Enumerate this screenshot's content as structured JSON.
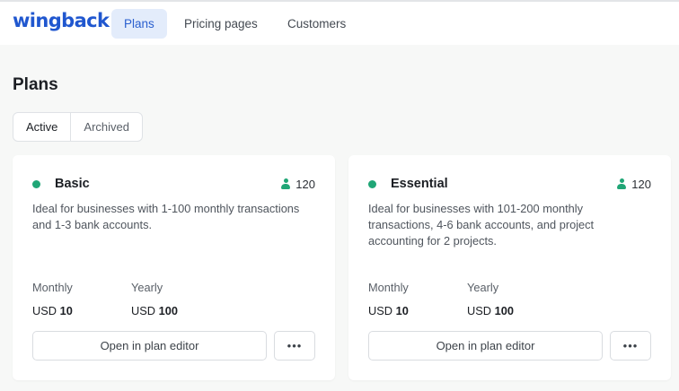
{
  "app": {
    "logo": "wingback"
  },
  "nav": {
    "items": [
      {
        "label": "Plans",
        "active": true
      },
      {
        "label": "Pricing pages",
        "active": false
      },
      {
        "label": "Customers",
        "active": false
      }
    ]
  },
  "page": {
    "title": "Plans"
  },
  "tabs": [
    {
      "label": "Active",
      "active": true
    },
    {
      "label": "Archived",
      "active": false
    }
  ],
  "colors": {
    "brand": "#2057cf",
    "nav_active_bg": "#e3ecfb",
    "status_active": "#20a676"
  },
  "plans": [
    {
      "name": "Basic",
      "status_color": "#20a676",
      "user_icon": "user-icon",
      "customer_count": "120",
      "description": "Ideal for businesses with 1-100 monthly transactions and 1-3 bank accounts.",
      "monthly_label": "Monthly",
      "monthly_currency": "USD",
      "monthly_amount": "10",
      "yearly_label": "Yearly",
      "yearly_currency": "USD",
      "yearly_amount": "100",
      "editor_button": "Open in plan editor",
      "more_button": "•••"
    },
    {
      "name": "Essential",
      "status_color": "#20a676",
      "user_icon": "user-icon",
      "customer_count": "120",
      "description": "Ideal for businesses with 101-200 monthly transactions, 4-6 bank accounts, and project accounting for 2 projects.",
      "monthly_label": "Monthly",
      "monthly_currency": "USD",
      "monthly_amount": "10",
      "yearly_label": "Yearly",
      "yearly_currency": "USD",
      "yearly_amount": "100",
      "editor_button": "Open in plan editor",
      "more_button": "•••"
    }
  ]
}
